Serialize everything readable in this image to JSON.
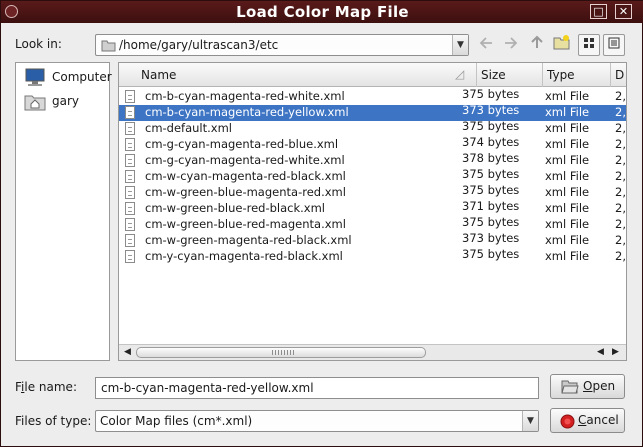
{
  "window": {
    "title": "Load Color Map File"
  },
  "lookin": {
    "label": "Look in:",
    "path": "/home/gary/ultrascan3/etc"
  },
  "toolbar": {
    "icons": [
      "back-arrow-icon",
      "forward-arrow-icon",
      "up-folder-icon",
      "new-folder-icon",
      "list-view-icon",
      "detail-view-icon"
    ]
  },
  "sidebar": {
    "items": [
      {
        "label": "Computer",
        "icon": "computer-icon"
      },
      {
        "label": "gary",
        "icon": "home-folder-icon"
      }
    ]
  },
  "filelist": {
    "columns": {
      "name": "Name",
      "size": "Size",
      "type": "Type",
      "date": "D"
    },
    "rows": [
      {
        "name": "cm-b-cyan-magenta-red-white.xml",
        "size": "375 bytes",
        "type": "xml File",
        "date": "2,"
      },
      {
        "name": "cm-b-cyan-magenta-red-yellow.xml",
        "size": "373 bytes",
        "type": "xml File",
        "date": "2,"
      },
      {
        "name": "cm-default.xml",
        "size": "375 bytes",
        "type": "xml File",
        "date": "2,"
      },
      {
        "name": "cm-g-cyan-magenta-red-blue.xml",
        "size": "374 bytes",
        "type": "xml File",
        "date": "2,"
      },
      {
        "name": "cm-g-cyan-magenta-red-white.xml",
        "size": "378 bytes",
        "type": "xml File",
        "date": "2,"
      },
      {
        "name": "cm-w-cyan-magenta-red-black.xml",
        "size": "375 bytes",
        "type": "xml File",
        "date": "2,"
      },
      {
        "name": "cm-w-green-blue-magenta-red.xml",
        "size": "375 bytes",
        "type": "xml File",
        "date": "2,"
      },
      {
        "name": "cm-w-green-blue-red-black.xml",
        "size": "371 bytes",
        "type": "xml File",
        "date": "2,"
      },
      {
        "name": "cm-w-green-blue-red-magenta.xml",
        "size": "375 bytes",
        "type": "xml File",
        "date": "2,"
      },
      {
        "name": "cm-w-green-magenta-red-black.xml",
        "size": "373 bytes",
        "type": "xml File",
        "date": "2,"
      },
      {
        "name": "cm-y-cyan-magenta-red-black.xml",
        "size": "375 bytes",
        "type": "xml File",
        "date": "2,"
      }
    ],
    "selected_index": 1
  },
  "filename": {
    "label_pre": "F",
    "label_ul": "i",
    "label_post": "le name:",
    "value": "cm-b-cyan-magenta-red-yellow.xml"
  },
  "filetype": {
    "label": "Files of type:",
    "value": "Color Map files (cm*.xml)"
  },
  "buttons": {
    "open": {
      "ul": "O",
      "rest": "pen"
    },
    "cancel": {
      "ul": "C",
      "rest": "ancel"
    }
  },
  "colors": {
    "titlebar": "#4a1515",
    "selection": "#3d74c4",
    "cancel_icon": "#d42020"
  }
}
